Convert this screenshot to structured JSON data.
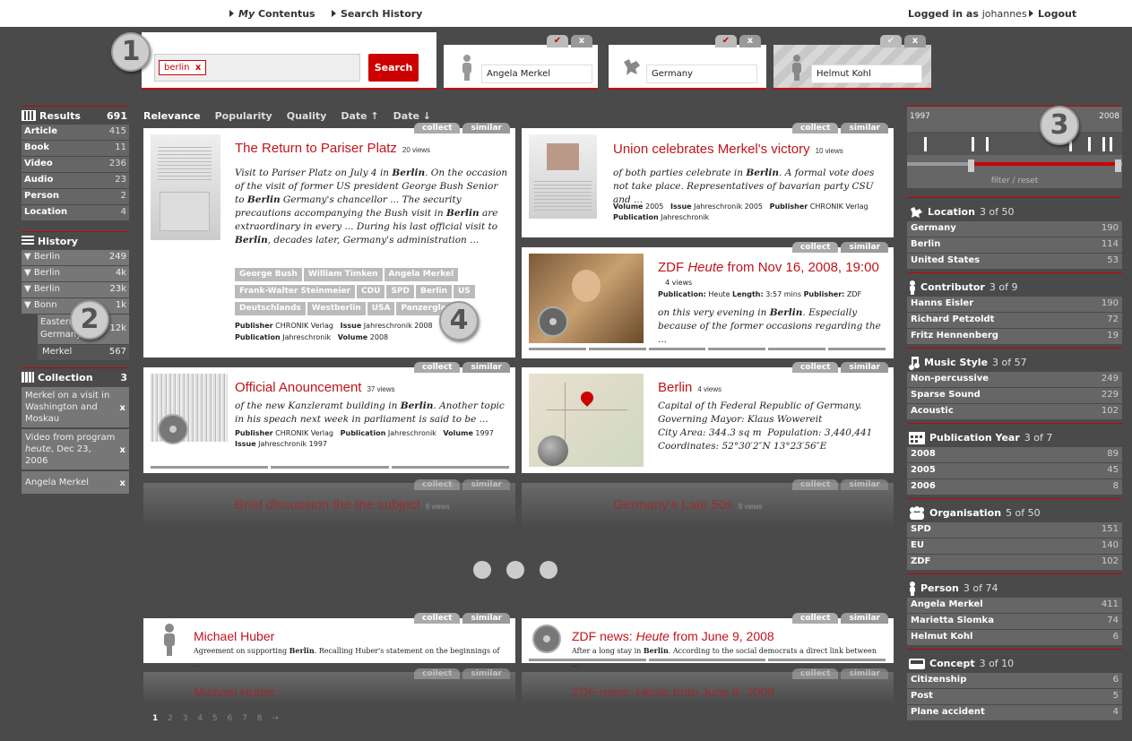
{
  "topbar": {
    "my_prefix": "My",
    "my_rest": " Contentus",
    "search_history": "Search History",
    "logged_in_label": "Logged in as",
    "username": "johannes",
    "logout": "Logout"
  },
  "badges": {
    "b1": "1",
    "b2": "2",
    "b3": "3",
    "b4": "4"
  },
  "search": {
    "token": "berlin",
    "token_remove": "x",
    "button": "Search"
  },
  "filters": [
    {
      "label": "Angela Merkel",
      "check": "✔",
      "close": "x"
    },
    {
      "label": "Germany",
      "check": "✔",
      "close": "x"
    },
    {
      "label": "Helmut Kohl",
      "check": "✔",
      "close": "x"
    }
  ],
  "results": {
    "title": "Results",
    "total": "691",
    "items": [
      {
        "label": "Article",
        "count": "415"
      },
      {
        "label": "Book",
        "count": "11"
      },
      {
        "label": "Video",
        "count": "236"
      },
      {
        "label": "Audio",
        "count": "23"
      },
      {
        "label": "Person",
        "count": "2"
      },
      {
        "label": "Location",
        "count": "4"
      }
    ]
  },
  "history": {
    "title": "History",
    "items": [
      {
        "label": "Berlin",
        "count": "249"
      },
      {
        "label": "Berlin",
        "count": "4k"
      },
      {
        "label": "Berlin",
        "count": "23k"
      },
      {
        "label": "Bonn",
        "count": "1k"
      },
      {
        "label": "Eastern Germany",
        "count": "12k"
      },
      {
        "label": "Merkel",
        "count": "567"
      }
    ]
  },
  "collection": {
    "title": "Collection",
    "count": "3",
    "items": [
      {
        "line1": "Merkel on a visit in Washington and Moskau",
        "x": "x"
      },
      {
        "line1": "Video from program",
        "italic": "heute",
        "rest": ", Dec 23, 2006",
        "x": "x"
      },
      {
        "line1": "Angela Merkel",
        "x": "x"
      }
    ]
  },
  "sort": {
    "relevance": "Relevance",
    "popularity": "Popularity",
    "quality": "Quality",
    "date_up": "Date ↑",
    "date_down": "Date ↓"
  },
  "tabs": {
    "collect": "collect",
    "similar": "similar"
  },
  "cards": {
    "c1": {
      "title": "The Return to Pariser Platz",
      "views": "20 views",
      "body_html": "Visit to Pariser Platz on July 4 in <b>Berlin</b>. On the occasion of the visit of former US president George Bush Senior to <b>Berlin</b> Germany's chancellor ... The security precautions accompanying the Bush visit in <b>Berlin</b> are extraordinary in every ... During his last official visit to <b>Berlin</b>, decades later, Germany's administration ...",
      "tags": [
        "George Bush",
        "William Timken",
        "Angela Merkel",
        "Frank-Walter Steinmeier",
        "CDU",
        "SPD",
        "Berlin",
        "US",
        "Deutschlands",
        "Westberlin",
        "USA",
        "Panzerglas"
      ],
      "meta1_html": "<b>Publisher</b> CHRONIK Verlag &nbsp; <b>Issue</b> Jahreschronik 2008",
      "meta2_html": "<b>Publication</b> Jahreschronik &nbsp; <b>Volume</b> 2008"
    },
    "c2": {
      "title": "Union celebrates Merkel's victory",
      "views": "10 views",
      "body_html": "of both parties celebrate in <b>Berlin</b>. A formal vote does not take place. Representatives of bavarian party CSU and ...",
      "meta1_html": "<b>Volume</b> 2005 &nbsp; <b>Issue</b> Jahreschronik 2005 &nbsp; <b>Publisher</b> CHRONIK Verlag",
      "meta2_html": "<b>Publication</b> Jahreschronik"
    },
    "c3": {
      "title_html": "ZDF <i>Heute</i> from Nov 16, 2008, 19:00",
      "views": "4 views",
      "meta1_html": "<b>Publication:</b> Heute <b>Length:</b> 3:57 mins <b>Publisher:</b> ZDF",
      "body_html": "on this very evening in <b>Berlin</b>. Especially because of the former occasions regarding the ..."
    },
    "c4": {
      "title": "Official Anouncement",
      "views": "37 views",
      "body_html": "of the new Kanzleramt building in <b>Berlin</b>. Another topic in his speach next week in parliament is said to be ...",
      "meta1_html": "<b>Publisher</b> CHRONIK Verlag &nbsp; <b>Publication</b> Jahreschronik &nbsp; <b>Volume</b> 1997",
      "meta2_html": "<b>Issue</b> Jahreschronik 1997"
    },
    "c5": {
      "title": "Berlin",
      "views": "4 views",
      "body_html": "Capital of th Federal Republic of Germany.<br>Governing Mayor: Klaus Wowereit<br>City Area: 344.3 sq m &nbsp;Population: 3,440,441<br>Coordinates: 52°30′2″N 13°23′56″E"
    },
    "f1": {
      "title": "Brief discussion the the subject",
      "views": "9 views"
    },
    "f2": {
      "title": "Germany's Late 50s",
      "views": "9 views"
    },
    "c6": {
      "title": "Michael Huber",
      "body_html": "Agreement on supporting <b>Berlin</b>. Recalling Huber's statement on the beginnings of ..."
    },
    "c7": {
      "title_html": "ZDF news: <i>Heute</i> from June 9, 2008",
      "body_html": "After a long stay in <b>Berlin</b>. According to the social democrats a direct link between ..."
    },
    "f3": {
      "title": "Michael Huber"
    },
    "f4": {
      "title_html": "ZDF news: <i>Heute</i> from June 9, 2008"
    }
  },
  "pagination": {
    "current": "1",
    "others": "2 3 4 5 6 7 8 →"
  },
  "timeline": {
    "start": "1997",
    "end": "2008",
    "filter": "filter",
    "sep": " / ",
    "reset": "reset"
  },
  "facets": [
    {
      "id": "location",
      "title": "Location",
      "count": "3 of 50",
      "icon": "location-icon",
      "items": [
        {
          "label": "Germany",
          "count": "190"
        },
        {
          "label": "Berlin",
          "count": "114"
        },
        {
          "label": "United States",
          "count": "53"
        }
      ]
    },
    {
      "id": "contributor",
      "title": "Contributor",
      "count": "3 of 9",
      "icon": "person-icon",
      "items": [
        {
          "label": "Hanns Eisler",
          "count": "190"
        },
        {
          "label": "Richard Petzoldt",
          "count": "72"
        },
        {
          "label": "Fritz Hennenberg",
          "count": "19"
        }
      ]
    },
    {
      "id": "music",
      "title": "Music Style",
      "count": "3 of 57",
      "icon": "music-note-icon",
      "items": [
        {
          "label": "Non-percussive",
          "count": "249"
        },
        {
          "label": "Sparse Sound",
          "count": "229"
        },
        {
          "label": "Acoustic",
          "count": "102"
        }
      ]
    },
    {
      "id": "pubyear",
      "title": "Publication Year",
      "count": "3 of 7",
      "icon": "calendar-icon",
      "items": [
        {
          "label": "2008",
          "count": "89"
        },
        {
          "label": "2005",
          "count": "45"
        },
        {
          "label": "2006",
          "count": "8"
        }
      ]
    },
    {
      "id": "organisation",
      "title": "Organisation",
      "count": "5 of 50",
      "icon": "group-icon",
      "items": [
        {
          "label": "SPD",
          "count": "151"
        },
        {
          "label": "EU",
          "count": "140"
        },
        {
          "label": "ZDF",
          "count": "102"
        }
      ]
    },
    {
      "id": "person",
      "title": "Person",
      "count": "3 of 74",
      "icon": "person-icon",
      "items": [
        {
          "label": "Angela Merkel",
          "count": "411"
        },
        {
          "label": "Marietta Slomka",
          "count": "74"
        },
        {
          "label": "Helmut Kohl",
          "count": "6"
        }
      ]
    },
    {
      "id": "concept",
      "title": "Concept",
      "count": "3 of 10",
      "icon": "concept-icon",
      "items": [
        {
          "label": "Citizenship",
          "count": "6"
        },
        {
          "label": "Post",
          "count": "5"
        },
        {
          "label": "Plane accident",
          "count": "4"
        }
      ]
    }
  ]
}
